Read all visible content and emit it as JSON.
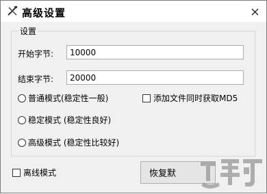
{
  "window": {
    "title": "高级设置",
    "close_glyph": "✕"
  },
  "group": {
    "label": "设置"
  },
  "start_byte": {
    "label": "开始字节:",
    "value": "10000"
  },
  "end_byte": {
    "label": "结束字节:",
    "value": "20000"
  },
  "modes": [
    {
      "label": "普通模式(稳定性一般)",
      "selected": false
    },
    {
      "label": "稳定模式 (稳定性良好)",
      "selected": false
    },
    {
      "label": "高级模式 (稳定性比较好)",
      "selected": false
    }
  ],
  "add_md5": {
    "label": "添加文件同时获取MD5",
    "checked": false
  },
  "offline_mode": {
    "label": "离线模式",
    "checked": false
  },
  "restore_button": {
    "label": "恢复默"
  },
  "colors": {
    "window_bg": "#f0f0f0",
    "titlebar_bg": "#ffffff",
    "watermark": "#9a9a9a"
  }
}
